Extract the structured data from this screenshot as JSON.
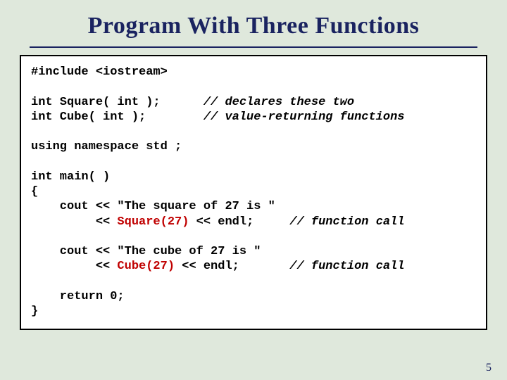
{
  "title": "Program With Three Functions",
  "page_number": "5",
  "code": {
    "l01": "#include <iostream>",
    "blank": " ",
    "l02a": "int Square( int );      ",
    "l02b": "// declares these two",
    "l03a": "int Cube( int );        ",
    "l03b": "// value-returning functions",
    "l04": "using namespace std ;",
    "l05": "int main( )",
    "l06": "{",
    "l07": "    cout << \"The square of 27 is \"",
    "l08a": "         << ",
    "l08b": "Square(27)",
    "l08c": " << endl;     ",
    "l08d": "// function call",
    "l09": "    cout << \"The cube of 27 is \"",
    "l10a": "         << ",
    "l10b": "Cube(27)",
    "l10c": " << endl;       ",
    "l10d": "// function call",
    "l11": "    return 0;",
    "l12": "}"
  }
}
